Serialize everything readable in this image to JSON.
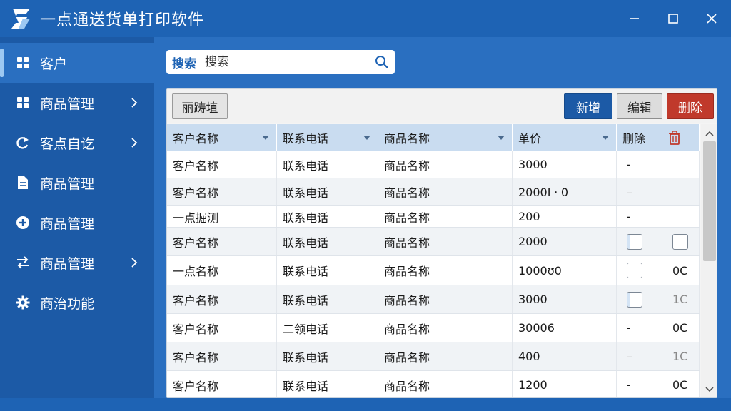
{
  "window": {
    "title": "一点通送货单打印软件",
    "icons": {
      "logo": "app-logo-icon",
      "minimize": "minimize-icon",
      "maximize": "maximize-icon",
      "close": "close-icon"
    }
  },
  "sidebar": {
    "items": [
      {
        "label": "客户",
        "icon": "grid-icon",
        "active": true,
        "chevron": false
      },
      {
        "label": "商品管理",
        "icon": "grid-icon",
        "active": false,
        "chevron": true
      },
      {
        "label": "客点自讫",
        "icon": "refresh-icon",
        "active": false,
        "chevron": true
      },
      {
        "label": "商品管理",
        "icon": "document-icon",
        "active": false,
        "chevron": false
      },
      {
        "label": "商品管理",
        "icon": "plus-circle-icon",
        "active": false,
        "chevron": false
      },
      {
        "label": "商品管理",
        "icon": "transfer-icon",
        "active": false,
        "chevron": true
      },
      {
        "label": "商治功能",
        "icon": "gear-icon",
        "active": false,
        "chevron": false
      }
    ]
  },
  "search": {
    "label": "搜索",
    "placeholder": "搜索",
    "value": "",
    "icon": "search-icon"
  },
  "toolbar": {
    "filter_label": "丽踌埴",
    "add_label": "新增",
    "edit_label": "编辑",
    "delete_label": "删除"
  },
  "table": {
    "columns": [
      "客户名称",
      "联系电话",
      "商品名称",
      "单价",
      "删除",
      "trash-icon"
    ],
    "rows": [
      {
        "name": "客户名称",
        "phone": "联系电话",
        "product": "商品名称",
        "price": "3000",
        "del": "-",
        "extra": ""
      },
      {
        "name": "客户名称",
        "phone": "联系电话",
        "product": "商品名称",
        "price": "2000I ⸱ 0",
        "del": "–",
        "extra": ""
      },
      {
        "name": "一点掘测",
        "phone": "联系电话",
        "product": "商品名称",
        "price": "200",
        "del": "-",
        "extra": ""
      },
      {
        "name": "客户名称",
        "phone": "联系电话",
        "product": "商品名称",
        "price": "2000",
        "del": "checkbox-half",
        "extra": "checkbox"
      },
      {
        "name": "一点名称",
        "phone": "联系电话",
        "product": "商品名称",
        "price": "1000ʊ0",
        "del": "checkbox",
        "extra": "0C"
      },
      {
        "name": "客户名称",
        "phone": "联系电话",
        "product": "商品名称",
        "price": "3000",
        "del": "checkbox-half",
        "extra": "1C"
      },
      {
        "name": "客户名称",
        "phone": "二领电话",
        "product": "商品名称",
        "price": "30006",
        "del": "-",
        "extra": "0C"
      },
      {
        "name": "客户名称",
        "phone": "联系电话",
        "product": "商品名称",
        "price": "400",
        "del": "–",
        "extra": "1C"
      },
      {
        "name": "客户名称",
        "phone": "联系电话",
        "product": "商品名称",
        "price": "1200",
        "del": "-",
        "extra": "0C"
      }
    ]
  },
  "colors": {
    "titlebar": "#1e63b4",
    "sidebar": "#1c5aa6",
    "accent": "#1c5aa6",
    "danger": "#c0392b"
  }
}
